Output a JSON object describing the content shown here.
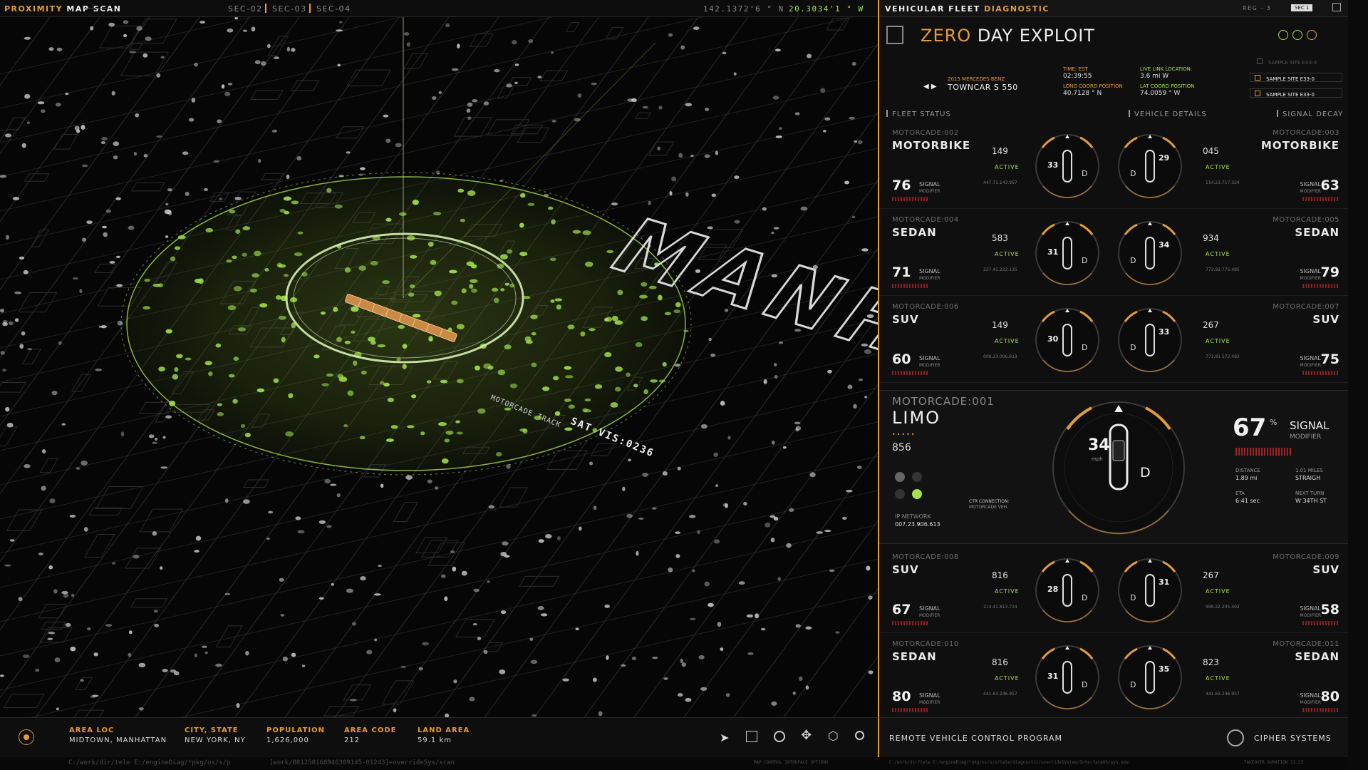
{
  "top": {
    "title_a": "PROXIMITY",
    "title_b": "MAP SCAN",
    "sec": [
      "SEC-02",
      "SEC-03",
      "SEC-04"
    ],
    "coord_n": "142.1372'6 ° N",
    "coord_w": "20.3034'1 ° W"
  },
  "panel": {
    "title_a": "VEHICULAR FLEET",
    "title_b": "DIAGNOSTIC",
    "reg": "REG - 3",
    "sec": "SEC 1",
    "exploit_a": "ZERO",
    "exploit_b": "DAY EXPLOIT",
    "car_year": "2015 MERCEDES-BENZ",
    "car_model": "TOWNCAR S 550",
    "time_lbl": "TIME: EST",
    "time_val": "02:39:55",
    "long_lbl": "LONG COORD POSITION",
    "long_val": "40.7128 ° N",
    "link_lbl": "LIVE LINK LOCATION:",
    "link_val": "3.6 mi W",
    "lat_lbl": "LAT COORD POSITION",
    "lat_val": "74.0059 ° W",
    "sites": [
      "SAMPLE SITE E33-0",
      "SAMPLE SITE E33-0",
      "SAMPLE SITE E33-0"
    ],
    "sections": [
      "FLEET STATUS",
      "VEHICLE DETAILS",
      "SIGNAL DECAY"
    ],
    "signal_lbl": "SIGNAL",
    "modifier_lbl": "MODIFIER",
    "active": "ACTIVE"
  },
  "vehicles": [
    {
      "id": "MOTORCADE:002",
      "type": "MOTORBIKE",
      "signal": "76",
      "val": "149",
      "ip": "447.71.143.957",
      "speed": "33"
    },
    {
      "id": "MOTORCADE:003",
      "type": "MOTORBIKE",
      "signal": "63",
      "val": "045",
      "ip": "114.23.717.324",
      "speed": "29"
    },
    {
      "id": "MOTORCADE:004",
      "type": "SEDAN",
      "signal": "71",
      "val": "583",
      "ip": "227.41.222.135",
      "speed": "31"
    },
    {
      "id": "MOTORCADE:005",
      "type": "SEDAN",
      "signal": "79",
      "val": "934",
      "ip": "773.92.775.485",
      "speed": "34"
    },
    {
      "id": "MOTORCADE:006",
      "type": "SUV",
      "signal": "60",
      "val": "149",
      "ip": "008.23.006.613",
      "speed": "30"
    },
    {
      "id": "MOTORCADE:007",
      "type": "SUV",
      "signal": "75",
      "val": "267",
      "ip": "771.81.572.483",
      "speed": "33"
    },
    {
      "id": "MOTORCADE:008",
      "type": "SUV",
      "signal": "67",
      "val": "816",
      "ip": "114.41.813.724",
      "speed": "28"
    },
    {
      "id": "MOTORCADE:009",
      "type": "SUV",
      "signal": "58",
      "val": "267",
      "ip": "999.22.295.502",
      "speed": "31"
    },
    {
      "id": "MOTORCADE:010",
      "type": "SEDAN",
      "signal": "80",
      "val": "816",
      "ip": "441.63.246.957",
      "speed": "31"
    },
    {
      "id": "MOTORCADE:011",
      "type": "SEDAN",
      "signal": "80",
      "val": "823",
      "ip": "441.63.246.957",
      "speed": "35"
    }
  ],
  "limo": {
    "id": "MOTORCADE:001",
    "type": "LIMO",
    "val": "856",
    "ip_lbl": "IP NETWORK",
    "ip": "007.23.906.613",
    "speed": "34",
    "unit": "mph",
    "gear": "D",
    "signal": "67",
    "pct": "%",
    "ctr": "CTR CONNECTION:",
    "ctr_val": "MOTORCADE VEH.",
    "dist_lbl": "DISTANCE",
    "dist_val": "1.89 mi",
    "miles_lbl": "1.01 MILES",
    "miles_val": "STRAIGH",
    "eta_lbl": "ETA",
    "eta_val": "6:41 sec",
    "turn_lbl": "NEXT TURN",
    "turn_val": "W 34TH ST"
  },
  "map": {
    "label": "MANH",
    "track": "MOTORCADE TRACK",
    "sat": "SAT VIS:0236"
  },
  "bottom": {
    "area_loc_lbl": "AREA LOC",
    "area_loc": "MIDTOWN, MANHATTAN",
    "city_lbl": "CITY, STATE",
    "city": "NEW YORK, NY",
    "pop_lbl": "POPULATION",
    "pop": "1,626,000",
    "code_lbl": "AREA CODE",
    "code": "212",
    "land_lbl": "LAND AREA",
    "land": "59.1 km",
    "remote": "REMOTE VEHICLE CONTROL PROGRAM",
    "brand": "CIPHER SYSTEMS",
    "path_a": "C:/work/dir/tele E:/engineDiag/*pkg/os/s/p",
    "path_b": "[work/881258168946309145-01243]+overrideSys/scan",
    "path_c": "MAP CONTROL INTERFACE OPTIONS",
    "path_d": "C:/work/dir/tele E:/engineDiag/*pkg/os/s/p/tele/diagnostic/overrideSystem/InterfaceOS/sys.exe",
    "path_e": "TAKEOVER DURATION 13:23"
  }
}
